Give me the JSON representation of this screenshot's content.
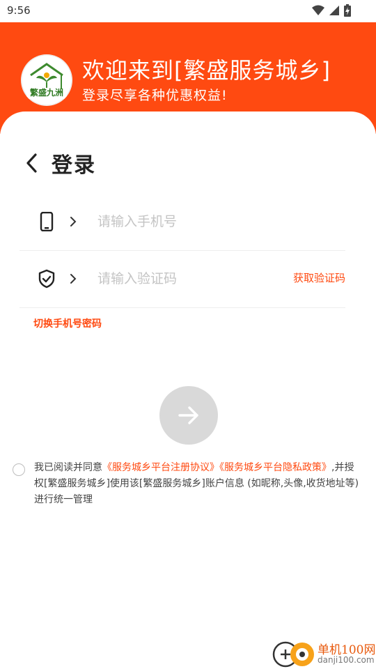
{
  "status_bar": {
    "time": "9:56"
  },
  "header": {
    "welcome": "欢迎来到[繁盛服务城乡]",
    "subtitle": "登录尽享各种优惠权益!",
    "logo_text": "繁盛九洲"
  },
  "page": {
    "title": "登录"
  },
  "phone_field": {
    "placeholder": "请输入手机号",
    "value": ""
  },
  "code_field": {
    "placeholder": "请输入验证码",
    "value": ""
  },
  "get_code_label": "获取验证码",
  "switch_label": "切换手机号密码",
  "agreement": {
    "prefix": "我已阅读并同意",
    "link1": "《服务城乡平台注册协议》",
    "link2": "《服务城乡平台隐私政策》",
    "suffix": ",并授权[繁盛服务城乡]使用该[繁盛服务城乡]账户信息 (如昵称,头像,收货地址等)进行统一管理"
  },
  "watermark": {
    "name": "单机100网",
    "url": "danji100.com"
  },
  "colors": {
    "accent": "#ff4a11",
    "submit_disabled": "#d9d9d9"
  }
}
